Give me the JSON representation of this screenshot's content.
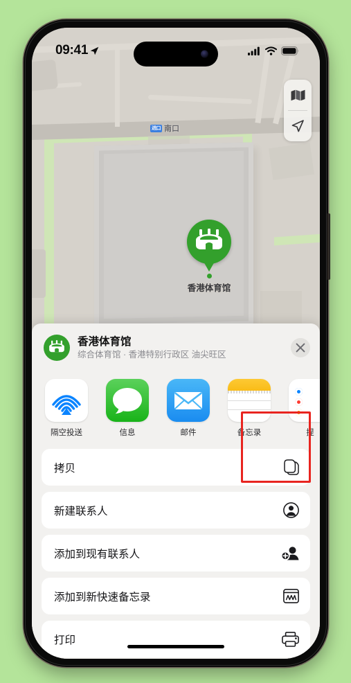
{
  "status_bar": {
    "time": "09:41",
    "location_icon": "location-arrow-icon",
    "cellular_icon": "cellular-bars-icon",
    "wifi_icon": "wifi-icon",
    "battery_icon": "battery-icon"
  },
  "map": {
    "label_badge": "进口",
    "label_text": "南口",
    "pin_label": "香港体育馆",
    "pin_icon": "stadium-icon",
    "controls": [
      {
        "name": "map-type-button",
        "icon": "folded-map-icon"
      },
      {
        "name": "locate-me-button",
        "icon": "navigation-arrow-icon"
      }
    ],
    "colors": {
      "pin": "#33a02c",
      "land": "#d6d2cb",
      "building": "#c9c7c4",
      "park": "#cfe6b6",
      "badge": "#3b7fe0"
    }
  },
  "share_sheet": {
    "title": "香港体育馆",
    "subtitle": "综合体育馆 · 香港特别行政区 油尖旺区",
    "place_icon": "stadium-icon",
    "close_label": "×",
    "apps": [
      {
        "label": "隔空投送",
        "icon": "airdrop-icon",
        "highlighted": false
      },
      {
        "label": "信息",
        "icon": "messages-icon",
        "highlighted": false
      },
      {
        "label": "邮件",
        "icon": "mail-icon",
        "highlighted": false
      },
      {
        "label": "备忘录",
        "icon": "notes-icon",
        "highlighted": true
      },
      {
        "label": "提",
        "icon": "reminders-icon",
        "highlighted": false
      }
    ],
    "actions": [
      {
        "label": "拷贝",
        "icon": "copy-icon"
      },
      {
        "label": "新建联系人",
        "icon": "person-circle-icon"
      },
      {
        "label": "添加到现有联系人",
        "icon": "person-add-icon"
      },
      {
        "label": "添加到新快速备忘录",
        "icon": "quick-note-icon"
      },
      {
        "label": "打印",
        "icon": "printer-icon"
      }
    ],
    "highlight_color": "#e8241f"
  },
  "background_color": "#b4e49a"
}
